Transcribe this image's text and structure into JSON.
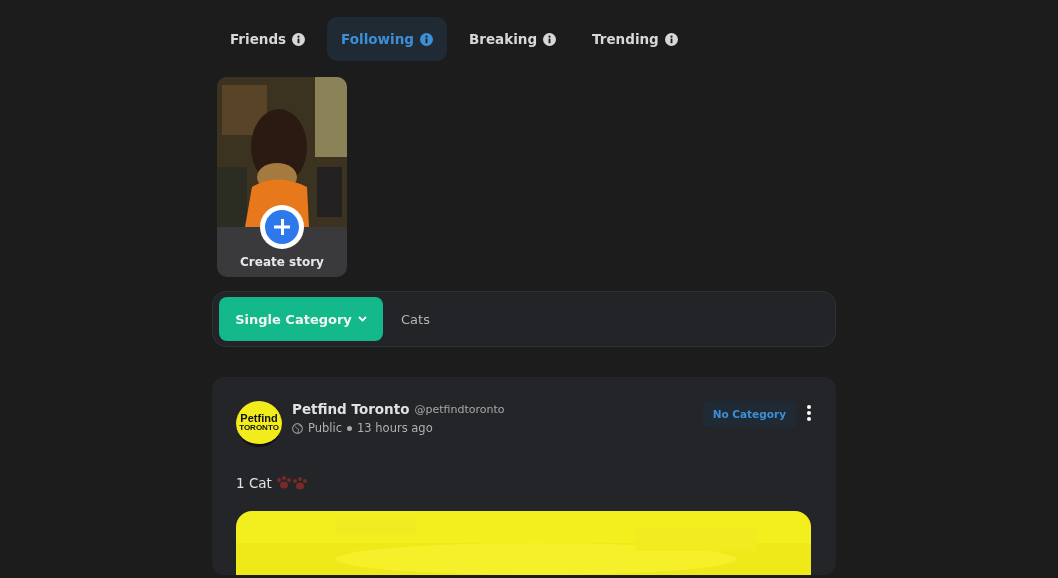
{
  "tabs": [
    {
      "label": "Friends",
      "selected": false
    },
    {
      "label": "Following",
      "selected": true
    },
    {
      "label": "Breaking",
      "selected": false
    },
    {
      "label": "Trending",
      "selected": false
    }
  ],
  "story": {
    "kind": "picture",
    "label": "Create story"
  },
  "filter": {
    "mode": "Single Category",
    "value": "Cats"
  },
  "post": {
    "avatar": {
      "line_1": "Petfind",
      "line_2": "TORONTO"
    },
    "author": "Petfind Toronto",
    "handle": "@petfindtoronto",
    "visibility": "Public",
    "time": "13 hours ago",
    "category": "No Category",
    "text": "1 Cat"
  }
}
